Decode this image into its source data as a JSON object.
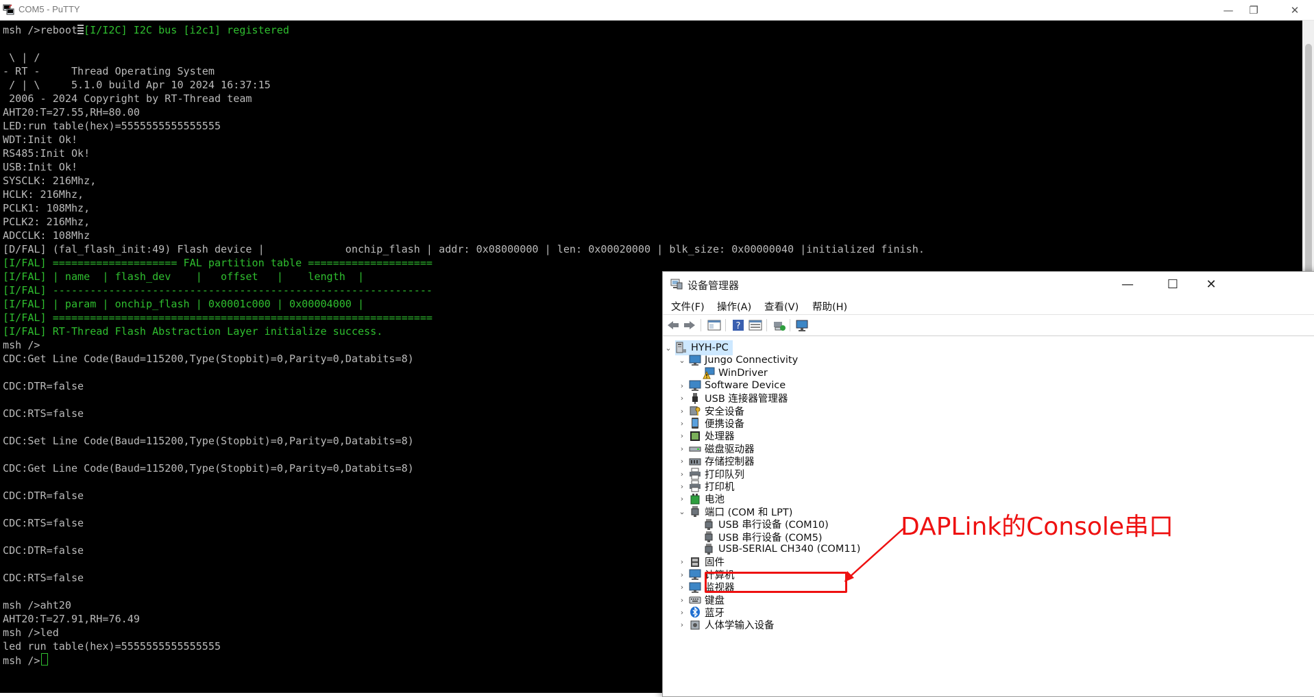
{
  "putty": {
    "title": "COM5 - PuTTY",
    "buttons": {
      "minimize": "—",
      "restore": "❐",
      "close": "✕"
    },
    "lines": [
      {
        "text": "msh />reboot",
        "suffix": "[I/I2C] I2C bus [i2c1] registered",
        "suffix_color": "green",
        "block_cursor": true
      },
      {
        "text": ""
      },
      {
        "text": " \\ | /"
      },
      {
        "text": "- RT -     Thread Operating System"
      },
      {
        "text": " / | \\     5.1.0 build Apr 10 2024 16:37:15"
      },
      {
        "text": " 2006 - 2024 Copyright by RT-Thread team"
      },
      {
        "text": "AHT20:T=27.55,RH=80.00"
      },
      {
        "text": "LED:run table(hex)=5555555555555555"
      },
      {
        "text": "WDT:Init Ok!"
      },
      {
        "text": "RS485:Init Ok!"
      },
      {
        "text": "USB:Init Ok!"
      },
      {
        "text": "SYSCLK: 216Mhz,"
      },
      {
        "text": "HCLK: 216Mhz,"
      },
      {
        "text": "PCLK1: 108Mhz,"
      },
      {
        "text": "PCLK2: 216Mhz,"
      },
      {
        "text": "ADCCLK: 108Mhz"
      },
      {
        "text": "[D/FAL] (fal_flash_init:49) Flash device |             onchip_flash | addr: 0x08000000 | len: 0x00020000 | blk_size: 0x00000040 |initialized finish."
      },
      {
        "text": "[I/FAL] ==================== FAL partition table ====================",
        "color": "green"
      },
      {
        "text": "[I/FAL] | name  | flash_dev    |   offset   |    length  |",
        "color": "green"
      },
      {
        "text": "[I/FAL] -------------------------------------------------------------",
        "color": "green"
      },
      {
        "text": "[I/FAL] | param | onchip_flash | 0x0001c000 | 0x00004000 |",
        "color": "green"
      },
      {
        "text": "[I/FAL] =============================================================",
        "color": "green"
      },
      {
        "text": "[I/FAL] RT-Thread Flash Abstraction Layer initialize success.",
        "color": "green"
      },
      {
        "text": "msh />"
      },
      {
        "text": "CDC:Get Line Code(Baud=115200,Type(Stopbit)=0,Parity=0,Databits=8)"
      },
      {
        "text": ""
      },
      {
        "text": "CDC:DTR=false"
      },
      {
        "text": ""
      },
      {
        "text": "CDC:RTS=false"
      },
      {
        "text": ""
      },
      {
        "text": "CDC:Set Line Code(Baud=115200,Type(Stopbit)=0,Parity=0,Databits=8)"
      },
      {
        "text": ""
      },
      {
        "text": "CDC:Get Line Code(Baud=115200,Type(Stopbit)=0,Parity=0,Databits=8)"
      },
      {
        "text": ""
      },
      {
        "text": "CDC:DTR=false"
      },
      {
        "text": ""
      },
      {
        "text": "CDC:RTS=false"
      },
      {
        "text": ""
      },
      {
        "text": "CDC:DTR=false"
      },
      {
        "text": ""
      },
      {
        "text": "CDC:RTS=false"
      },
      {
        "text": ""
      },
      {
        "text": "msh />aht20"
      },
      {
        "text": "AHT20:T=27.91,RH=76.49"
      },
      {
        "text": "msh />led"
      },
      {
        "text": "led run table(hex)=5555555555555555"
      },
      {
        "text": "msh />",
        "cursor": true
      }
    ]
  },
  "devmgr": {
    "title": "设备管理器",
    "buttons": {
      "minimize": "—",
      "maximize": "☐",
      "close": "✕"
    },
    "menu": [
      "文件(F)",
      "操作(A)",
      "查看(V)",
      "帮助(H)"
    ],
    "toolbar": [
      "back-arrow-icon",
      "forward-arrow-icon",
      "properties-icon",
      "help-icon",
      "view-icon",
      "update-driver-icon",
      "scan-hardware-icon"
    ],
    "tree": [
      {
        "label": "HYH-PC",
        "level": 0,
        "chevron": "⌄",
        "icon": "computer-icon",
        "selected": true
      },
      {
        "label": "Jungo Connectivity",
        "level": 1,
        "chevron": "⌄",
        "icon": "monitor-icon"
      },
      {
        "label": "WinDriver",
        "level": 2,
        "chevron": "",
        "icon": "warning-device-icon"
      },
      {
        "label": "Software Device",
        "level": 1,
        "chevron": "›",
        "icon": "monitor-icon"
      },
      {
        "label": "USB 连接器管理器",
        "level": 1,
        "chevron": "›",
        "icon": "usb-icon"
      },
      {
        "label": "安全设备",
        "level": 1,
        "chevron": "›",
        "icon": "security-device-icon"
      },
      {
        "label": "便携设备",
        "level": 1,
        "chevron": "›",
        "icon": "portable-device-icon"
      },
      {
        "label": "处理器",
        "level": 1,
        "chevron": "›",
        "icon": "processor-icon"
      },
      {
        "label": "磁盘驱动器",
        "level": 1,
        "chevron": "›",
        "icon": "disk-drive-icon"
      },
      {
        "label": "存储控制器",
        "level": 1,
        "chevron": "›",
        "icon": "storage-controller-icon"
      },
      {
        "label": "打印队列",
        "level": 1,
        "chevron": "›",
        "icon": "printer-icon"
      },
      {
        "label": "打印机",
        "level": 1,
        "chevron": "›",
        "icon": "printer-icon"
      },
      {
        "label": "电池",
        "level": 1,
        "chevron": "›",
        "icon": "battery-icon"
      },
      {
        "label": "端口 (COM 和 LPT)",
        "level": 1,
        "chevron": "⌄",
        "icon": "port-icon"
      },
      {
        "label": "USB 串行设备 (COM10)",
        "level": 2,
        "chevron": "",
        "icon": "port-icon"
      },
      {
        "label": "USB 串行设备 (COM5)",
        "level": 2,
        "chevron": "",
        "icon": "port-icon"
      },
      {
        "label": "USB-SERIAL CH340 (COM11)",
        "level": 2,
        "chevron": "",
        "icon": "port-icon"
      },
      {
        "label": "固件",
        "level": 1,
        "chevron": "›",
        "icon": "firmware-icon"
      },
      {
        "label": "计算机",
        "level": 1,
        "chevron": "›",
        "icon": "monitor-icon"
      },
      {
        "label": "监视器",
        "level": 1,
        "chevron": "›",
        "icon": "monitor-icon"
      },
      {
        "label": "键盘",
        "level": 1,
        "chevron": "›",
        "icon": "keyboard-icon"
      },
      {
        "label": "蓝牙",
        "level": 1,
        "chevron": "›",
        "icon": "bluetooth-icon"
      },
      {
        "label": "人体学输入设备",
        "level": 1,
        "chevron": "›",
        "icon": "hid-icon"
      }
    ]
  },
  "annotation": {
    "label": "DAPLink的Console串口",
    "color": "#ee1111"
  }
}
